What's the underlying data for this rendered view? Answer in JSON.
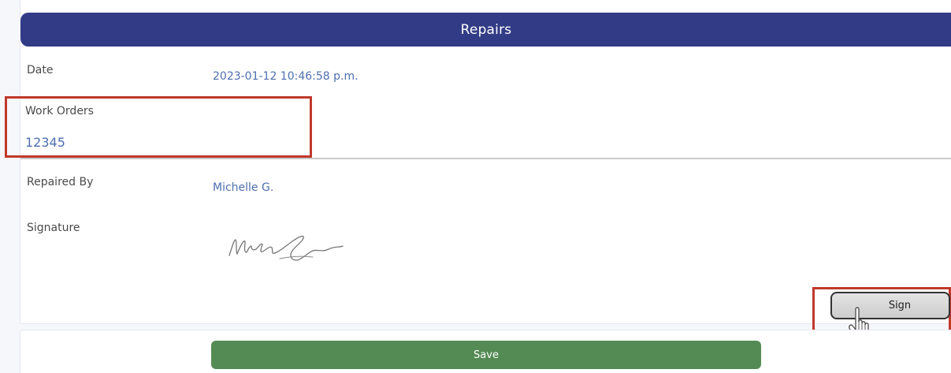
{
  "header": {
    "title": "Repairs"
  },
  "fields": {
    "date": {
      "label": "Date",
      "value": "2023-01-12 10:46:58 p.m."
    },
    "work_orders": {
      "label": "Work Orders",
      "value": "12345"
    },
    "repaired_by": {
      "label": "Repaired By",
      "value": "Michelle G."
    },
    "signature": {
      "label": "Signature"
    }
  },
  "buttons": {
    "sign": "Sign",
    "save": "Save"
  },
  "colors": {
    "header": "#323c86",
    "value_text": "#4f6fb0",
    "save_button": "#548b54",
    "highlight": "#c0392b"
  },
  "icons": [
    "signature-image",
    "hand-pointer-cursor-icon"
  ]
}
